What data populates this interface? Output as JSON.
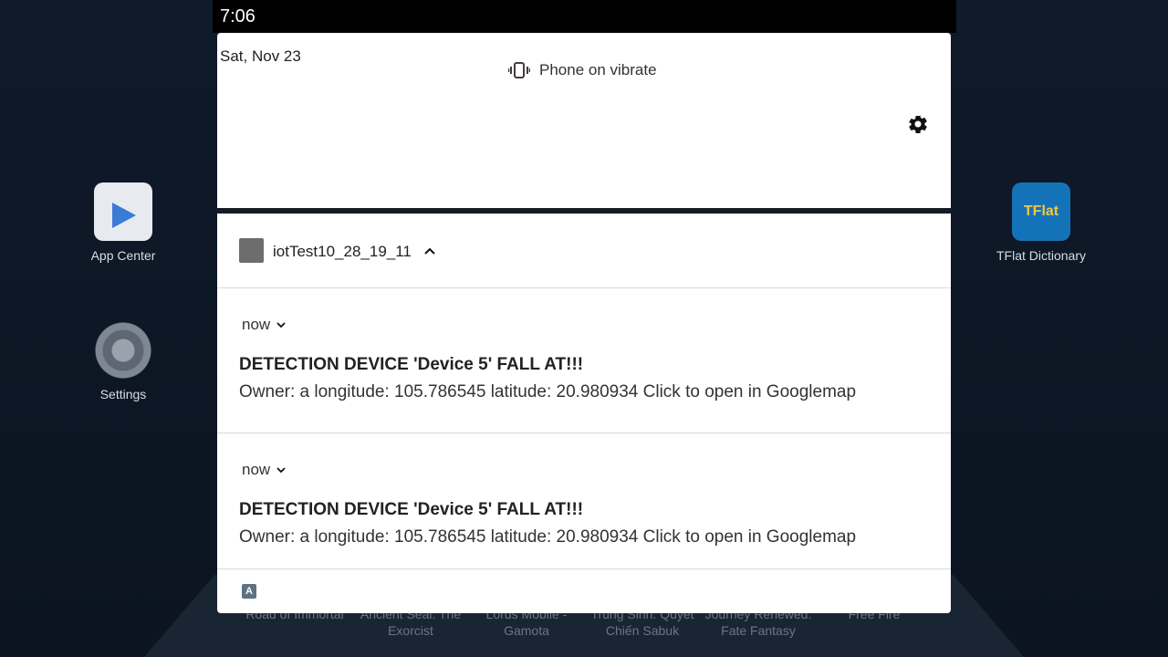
{
  "status_bar": {
    "time": "7:06"
  },
  "quick_settings": {
    "date": "Sat, Nov 23",
    "ringer_status": "Phone on vibrate",
    "ringer_icon": "vibrate-icon",
    "settings_icon": "gear-icon"
  },
  "notification_group": {
    "app_name": "iotTest10_28_19_11",
    "notifications": [
      {
        "time": "now",
        "title": "DETECTION DEVICE 'Device 5' FALL AT!!!",
        "body": "Owner: a longitude: 105.786545 latitude: 20.980934 Click to open in Googlemap"
      },
      {
        "time": "now",
        "title": "DETECTION DEVICE 'Device 5' FALL AT!!!",
        "body": "Owner: a longitude: 105.786545 latitude: 20.980934 Click to open in Googlemap"
      }
    ]
  },
  "desktop": {
    "apps": [
      {
        "label": "App Center"
      },
      {
        "label": "Settings"
      },
      {
        "label": "TFlat Dictionary"
      }
    ],
    "tflat_icon_text": "TFlat",
    "games": [
      {
        "label": "Road of Immortal"
      },
      {
        "label": "Ancient Seal: The Exorcist"
      },
      {
        "label": "Lords Mobile - Gamota"
      },
      {
        "label": "Trùng Sinh: Quyết Chiến Sabuk"
      },
      {
        "label": "Journey Renewed: Fate Fantasy"
      },
      {
        "label": "Free Fire"
      }
    ]
  }
}
